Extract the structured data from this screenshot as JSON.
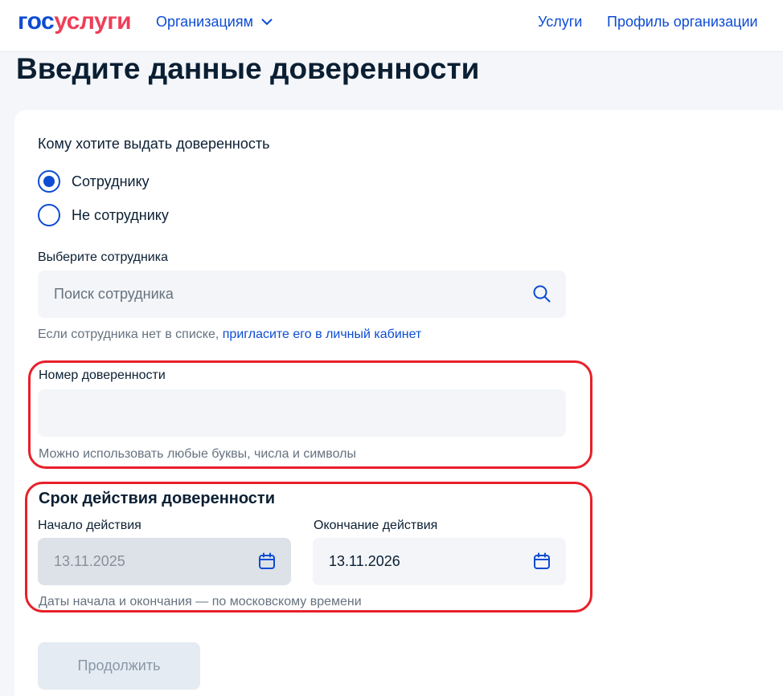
{
  "header": {
    "logo_part1": "гос",
    "logo_part2": "услуги",
    "org_menu_label": "Организациям",
    "nav": [
      "Услуги",
      "Профиль организации"
    ]
  },
  "page": {
    "title": "Введите данные доверенности"
  },
  "recipient": {
    "question": "Кому хотите выдать доверенность",
    "options": [
      {
        "label": "Сотруднику",
        "selected": true
      },
      {
        "label": "Не сотруднику",
        "selected": false
      }
    ]
  },
  "employee": {
    "label": "Выберите сотрудника",
    "placeholder": "Поиск сотрудника",
    "hint_text": "Если сотрудника нет в списке, ",
    "hint_link": "пригласите его в личный кабинет"
  },
  "poa_number": {
    "label": "Номер доверенности",
    "value": "",
    "hint": "Можно использовать любые буквы, числа и символы"
  },
  "validity": {
    "title": "Срок действия доверенности",
    "start_label": "Начало действия",
    "start_value": "13.11.2025",
    "end_label": "Окончание действия",
    "end_value": "13.11.2026",
    "hint": "Даты начала и окончания — по московскому времени"
  },
  "actions": {
    "continue_label": "Продолжить"
  },
  "colors": {
    "brand_blue": "#0d4cd3",
    "brand_red": "#ee3f58",
    "highlight_red": "#e8202a"
  }
}
